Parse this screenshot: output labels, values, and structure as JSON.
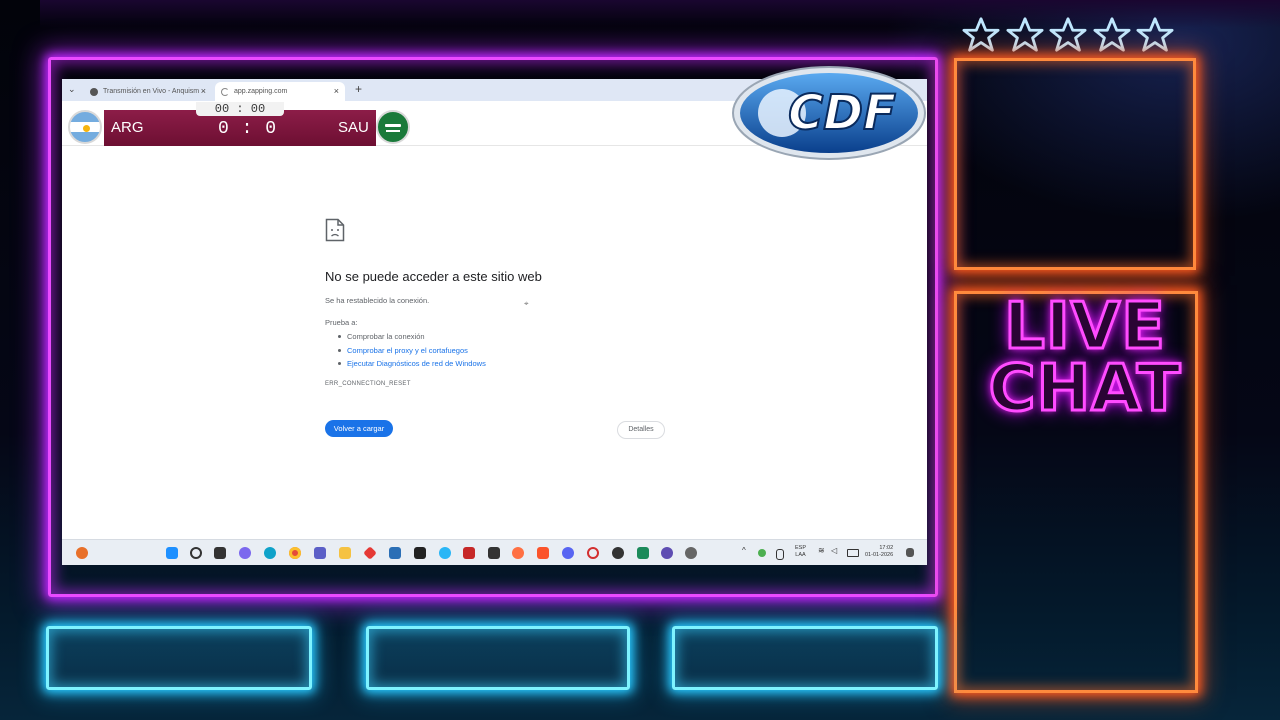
{
  "browser": {
    "tabs": [
      {
        "label": "Transmisión en Vivo - Anquism"
      },
      {
        "label": "app.zapping.com"
      }
    ],
    "new_tab": "+"
  },
  "error_page": {
    "title": "No se puede acceder a este sitio web",
    "subtitle": "Se ha restablecido la conexión.",
    "try_label": "Prueba a:",
    "suggestions": [
      "Comprobar la conexión",
      "Comprobar el proxy y el cortafuegos",
      "Ejecutar Diagnósticos de red de Windows"
    ],
    "error_code": "ERR_CONNECTION_RESET",
    "reload_button": "Volver a cargar",
    "details_button": "Detalles"
  },
  "scoreboard": {
    "time": "00 : 00",
    "home_team": "ARG",
    "away_team": "SAU",
    "score": "0 : 0"
  },
  "overlay": {
    "logo_text": "CDF",
    "live_chat_line1": "LIVE",
    "live_chat_line2": "CHAT",
    "stars_count": 5
  },
  "taskbar": {
    "language_line1": "ESP",
    "language_line2": "LAA",
    "clock_time": "17:02",
    "clock_date": "01-01-2026"
  },
  "colors": {
    "neon_pink": "#e94bff",
    "neon_orange": "#ff8a3d",
    "neon_blue": "#7ef3ff",
    "score_bar": "#8c1d48",
    "link_blue": "#1a73e8"
  }
}
